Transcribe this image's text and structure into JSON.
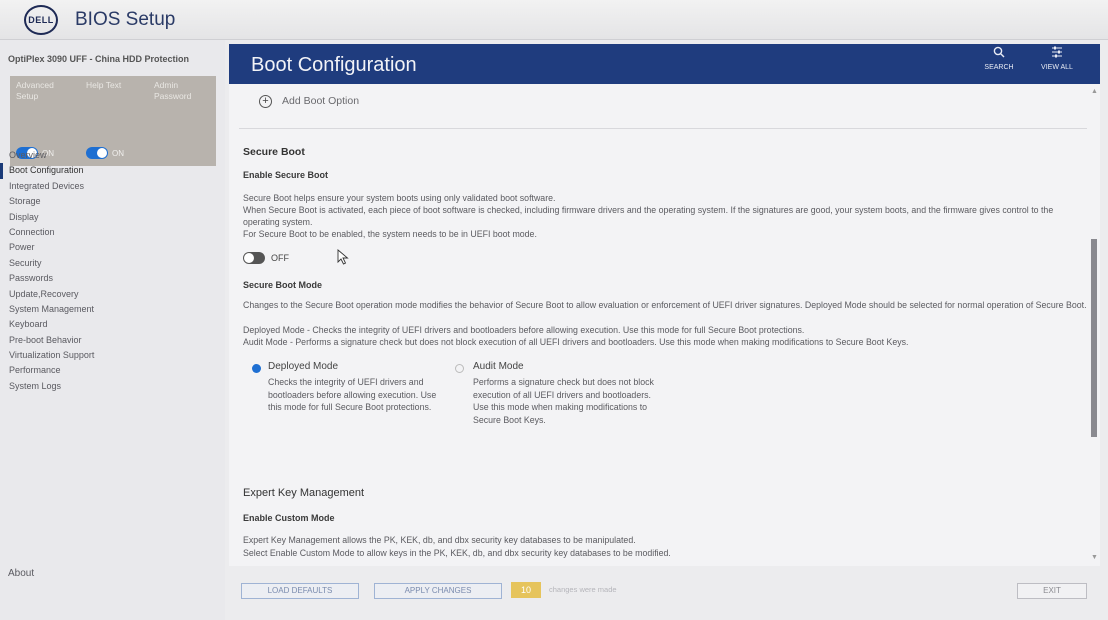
{
  "app": {
    "logo_text": "DELL",
    "title": "BIOS Setup"
  },
  "sidebar": {
    "product": "OptiPlex 3090 UFF - China HDD Protection",
    "tiles": [
      {
        "label": "Advanced Setup",
        "toggle": "ON"
      },
      {
        "label": "Help Text",
        "toggle": "ON"
      },
      {
        "label": "Admin Password"
      }
    ],
    "items": [
      "Overview",
      "Boot Configuration",
      "Integrated Devices",
      "Storage",
      "Display",
      "Connection",
      "Power",
      "Security",
      "Passwords",
      "Update,Recovery",
      "System Management",
      "Keyboard",
      "Pre-boot Behavior",
      "Virtualization Support",
      "Performance",
      "System Logs"
    ],
    "active_index": 1,
    "about": "About"
  },
  "header": {
    "title": "Boot Configuration",
    "search_label": "SEARCH",
    "viewall_label": "VIEW ALL"
  },
  "content": {
    "add_boot": "Add Boot Option",
    "secure_boot": {
      "heading": "Secure Boot",
      "sub": "Enable Secure Boot",
      "desc1": "Secure Boot helps ensure your system boots using only validated boot software.",
      "desc2": "When Secure Boot is activated, each piece of boot software is checked, including firmware drivers and the operating system. If the signatures are good, your system boots, and the firmware gives control to the operating system.",
      "desc3": "For Secure Boot to be enabled, the system needs to be in UEFI boot mode.",
      "toggle": "OFF"
    },
    "secure_boot_mode": {
      "sub": "Secure Boot Mode",
      "desc1": "Changes to the Secure Boot operation mode modifies the behavior of Secure Boot to allow evaluation or enforcement of UEFI driver signatures. Deployed Mode should be selected for normal operation of Secure Boot.",
      "desc2": "Deployed Mode - Checks the integrity of UEFI drivers and bootloaders before allowing execution. Use this mode for full Secure Boot protections.",
      "desc3": "Audit Mode - Performs a signature check but does not block execution of all UEFI drivers and bootloaders.  Use this mode when making modifications to Secure Boot Keys.",
      "options": [
        {
          "label": "Deployed Mode",
          "desc": "Checks the integrity of UEFI drivers and bootloaders before allowing execution. Use this mode for full Secure Boot protections.",
          "selected": true
        },
        {
          "label": "Audit Mode",
          "desc": "Performs a signature check but does not block execution of all UEFI drivers and bootloaders.  Use this mode when making modifications to Secure Boot Keys.",
          "selected": false
        }
      ]
    },
    "expert_key": {
      "heading": "Expert Key Management",
      "sub": "Enable Custom Mode",
      "desc1": "Expert Key Management allows the PK, KEK, db, and dbx security key databases to be manipulated.",
      "desc2": "Select Enable Custom Mode to allow keys in the PK, KEK, db, and dbx security key databases to be modified."
    }
  },
  "footer": {
    "load_defaults": "LOAD DEFAULTS",
    "apply_changes": "APPLY CHANGES",
    "changes_count": "10",
    "changes_text": "changes were made",
    "exit": "EXIT"
  },
  "colors": {
    "header_bg": "#1f3c7e",
    "accent": "#1e6fd2",
    "tile_bg": "#b8b3ad",
    "badge": "#e6c45c"
  },
  "icons": {
    "search": "search-icon",
    "view_all": "view-all-icon",
    "add": "plus-circle-icon"
  }
}
